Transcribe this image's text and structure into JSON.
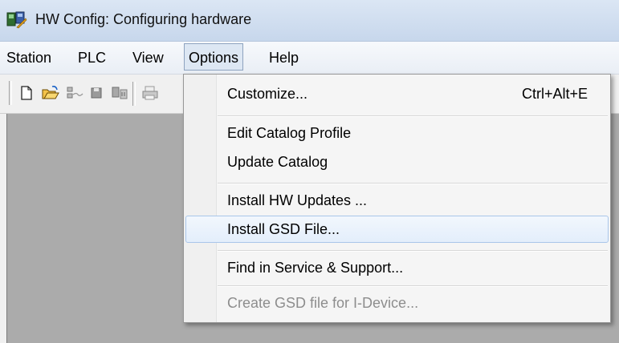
{
  "window": {
    "title": "HW Config: Configuring hardware",
    "app_icon": "hw-config-app-icon"
  },
  "menubar": {
    "items": [
      {
        "label": "Station"
      },
      {
        "label": "PLC"
      },
      {
        "label": "View"
      },
      {
        "label": "Options",
        "open": true
      },
      {
        "label": "Help"
      }
    ]
  },
  "toolbar": {
    "buttons": [
      "new-icon",
      "open-icon",
      "network-icon",
      "save-icon",
      "download-icon",
      "print-icon"
    ]
  },
  "options_menu": {
    "items": [
      {
        "label": "Customize...",
        "shortcut": "Ctrl+Alt+E"
      },
      {
        "label": "Edit Catalog Profile"
      },
      {
        "label": "Update Catalog"
      },
      {
        "label": "Install HW Updates ..."
      },
      {
        "label": "Install GSD File...",
        "highlighted": true
      },
      {
        "label": "Find in Service & Support..."
      },
      {
        "label": "Create GSD file for I-Device...",
        "disabled": true
      }
    ]
  },
  "colors": {
    "workspace": "#ababab",
    "highlight_border": "#a9c6ea",
    "disabled_text": "#8d8d8d"
  }
}
